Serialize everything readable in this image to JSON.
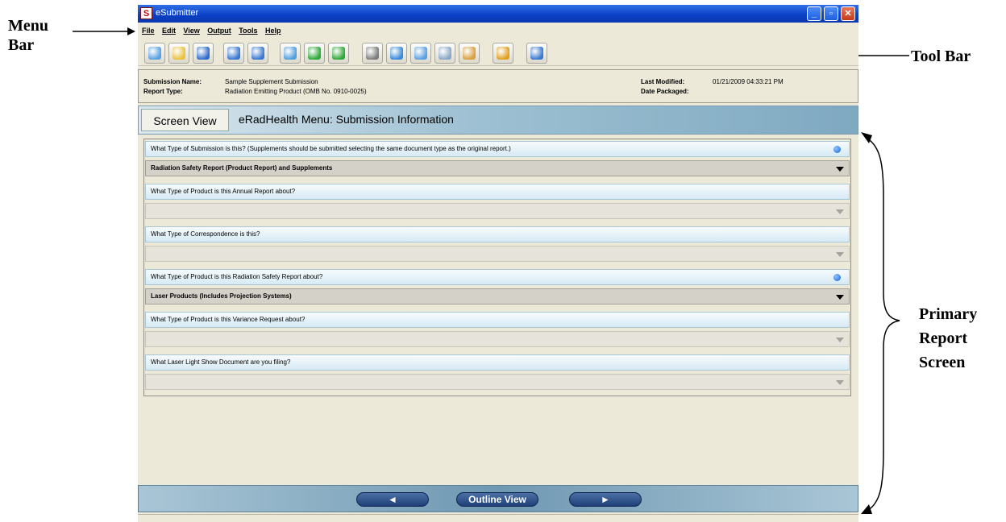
{
  "annotations": {
    "menu_bar": "Menu\nBar",
    "tool_bar": "Tool Bar",
    "primary_report_screen": "Primary\nReport\nScreen"
  },
  "window": {
    "app_icon": "S",
    "title": "eSubmitter",
    "controls": [
      "minimize-icon",
      "restore-icon",
      "close-icon"
    ]
  },
  "menu": [
    "File",
    "Edit",
    "View",
    "Output",
    "Tools",
    "Help"
  ],
  "toolbar": [
    {
      "icon": "new-document-icon",
      "color": "#5aa0e0"
    },
    {
      "icon": "open-folder-icon",
      "color": "#e8c240"
    },
    {
      "icon": "save-disk-icon",
      "color": "#2f6cc8"
    },
    {
      "icon": "single-window-icon",
      "color": "#3a78d0"
    },
    {
      "icon": "split-window-icon",
      "color": "#3a78d0"
    },
    {
      "icon": "home-icon",
      "color": "#4f9fdc"
    },
    {
      "icon": "back-arrow-icon",
      "color": "#2fa83a"
    },
    {
      "icon": "forward-arrow-icon",
      "color": "#2fa83a"
    },
    {
      "icon": "settings-gears-icon",
      "color": "#7d7d7d"
    },
    {
      "icon": "refresh-icon",
      "color": "#3a8ad8"
    },
    {
      "icon": "cut-scissors-icon",
      "color": "#5aa0e0"
    },
    {
      "icon": "copy-icon",
      "color": "#8aa8c8"
    },
    {
      "icon": "paste-clipboard-icon",
      "color": "#d8a040"
    },
    {
      "icon": "package-icon",
      "color": "#e0a020"
    },
    {
      "icon": "help-icon",
      "color": "#3a78d0"
    }
  ],
  "info": {
    "submission_name_label": "Submission Name:",
    "submission_name": "Sample Supplement Submission",
    "report_type_label": "Report Type:",
    "report_type": "Radiation Emitting Product (OMB No. 0910-0025)",
    "last_modified_label": "Last Modified:",
    "last_modified": "01/21/2009 04:33:21 PM",
    "date_packaged_label": "Date Packaged:",
    "date_packaged": ""
  },
  "screen": {
    "view_label": "Screen View",
    "title": "eRadHealth Menu: Submission Information"
  },
  "questions": [
    {
      "text": "What Type of Submission is this?  (Supplements should be submitted selecting the same document type as the original report.)",
      "required": true,
      "value": "Radiation Safety Report (Product Report) and Supplements",
      "enabled": true
    },
    {
      "text": "What Type of Product is this Annual Report about?",
      "required": false,
      "value": "",
      "enabled": false
    },
    {
      "text": "What Type of Correspondence is this?",
      "required": false,
      "value": "",
      "enabled": false
    },
    {
      "text": "What Type of Product is this Radiation Safety Report about?",
      "required": true,
      "value": "Laser Products (Includes Projection Systems)",
      "enabled": true
    },
    {
      "text": "What Type of Product is this Variance Request about?",
      "required": false,
      "value": "",
      "enabled": false
    },
    {
      "text": "What Laser Light Show Document are you filing?",
      "required": false,
      "value": "",
      "enabled": false
    }
  ],
  "nav": {
    "back": "◄",
    "outline": "Outline View",
    "forward": "►"
  }
}
